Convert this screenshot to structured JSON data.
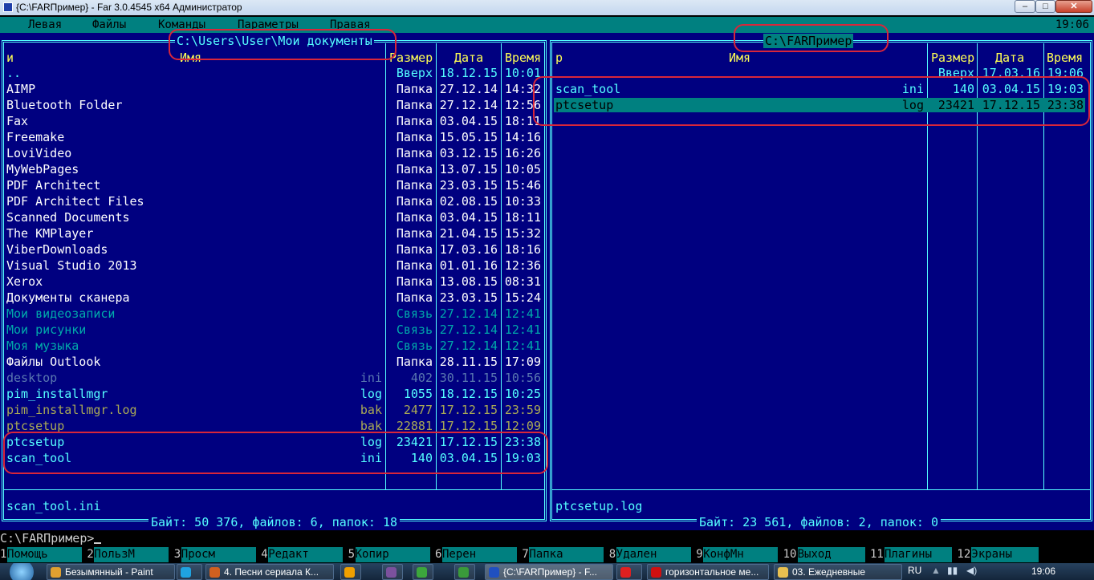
{
  "window": {
    "title": "{C:\\FARПример} - Far 3.0.4545 x64 Администратор",
    "min": "–",
    "max": "□",
    "close": "✕"
  },
  "menu": {
    "items": [
      "Левая",
      "Файлы",
      "Команды",
      "Параметры",
      "Правая"
    ],
    "clock": "19:06"
  },
  "left_panel": {
    "title": " C:\\Users\\User\\Мои документы ",
    "headers": {
      "n": "и",
      "name": "Имя",
      "size": "Размер",
      "date": "Дата",
      "time": "Время"
    },
    "rows": [
      {
        "name": "..",
        "ext": "",
        "size": "Вверх",
        "date": "18.12.15",
        "time": "10:01",
        "type": "up"
      },
      {
        "name": "AIMP",
        "ext": "",
        "size": "Папка",
        "date": "27.12.14",
        "time": "14:32",
        "type": "dir"
      },
      {
        "name": "Bluetooth Folder",
        "ext": "",
        "size": "Папка",
        "date": "27.12.14",
        "time": "12:56",
        "type": "dir"
      },
      {
        "name": "Fax",
        "ext": "",
        "size": "Папка",
        "date": "03.04.15",
        "time": "18:11",
        "type": "dir"
      },
      {
        "name": "Freemake",
        "ext": "",
        "size": "Папка",
        "date": "15.05.15",
        "time": "14:16",
        "type": "dir"
      },
      {
        "name": "LoviVideo",
        "ext": "",
        "size": "Папка",
        "date": "03.12.15",
        "time": "16:26",
        "type": "dir"
      },
      {
        "name": "MyWebPages",
        "ext": "",
        "size": "Папка",
        "date": "13.07.15",
        "time": "10:05",
        "type": "dir"
      },
      {
        "name": "PDF Architect",
        "ext": "",
        "size": "Папка",
        "date": "23.03.15",
        "time": "15:46",
        "type": "dir"
      },
      {
        "name": "PDF Architect Files",
        "ext": "",
        "size": "Папка",
        "date": "02.08.15",
        "time": "10:33",
        "type": "dir"
      },
      {
        "name": "Scanned Documents",
        "ext": "",
        "size": "Папка",
        "date": "03.04.15",
        "time": "18:11",
        "type": "dir"
      },
      {
        "name": "The KMPlayer",
        "ext": "",
        "size": "Папка",
        "date": "21.04.15",
        "time": "15:32",
        "type": "dir"
      },
      {
        "name": "ViberDownloads",
        "ext": "",
        "size": "Папка",
        "date": "17.03.16",
        "time": "18:16",
        "type": "dir"
      },
      {
        "name": "Visual Studio 2013",
        "ext": "",
        "size": "Папка",
        "date": "01.01.16",
        "time": "12:36",
        "type": "dir"
      },
      {
        "name": "Xerox",
        "ext": "",
        "size": "Папка",
        "date": "13.08.15",
        "time": "08:31",
        "type": "dir"
      },
      {
        "name": "Документы сканера",
        "ext": "",
        "size": "Папка",
        "date": "23.03.15",
        "time": "15:24",
        "type": "dir"
      },
      {
        "name": "Мои видеозаписи",
        "ext": "",
        "size": "Связь",
        "date": "27.12.14",
        "time": "12:41",
        "type": "link"
      },
      {
        "name": "Мои рисунки",
        "ext": "",
        "size": "Связь",
        "date": "27.12.14",
        "time": "12:41",
        "type": "link"
      },
      {
        "name": "Моя музыка",
        "ext": "",
        "size": "Связь",
        "date": "27.12.14",
        "time": "12:41",
        "type": "link"
      },
      {
        "name": "Файлы Outlook",
        "ext": "",
        "size": "Папка",
        "date": "28.11.15",
        "time": "17:09",
        "type": "dir"
      },
      {
        "name": "desktop",
        "ext": "ini",
        "size": "402",
        "date": "30.11.15",
        "time": "10:56",
        "type": "dim"
      },
      {
        "name": "pim_installmgr",
        "ext": "log",
        "size": "1055",
        "date": "18.12.15",
        "time": "10:25",
        "type": "file"
      },
      {
        "name": "pim_installmgr.log",
        "ext": "bak",
        "size": "2477",
        "date": "17.12.15",
        "time": "23:59",
        "type": "bak"
      },
      {
        "name": "ptcsetup",
        "ext": "bak",
        "size": "22881",
        "date": "17.12.15",
        "time": "12:09",
        "type": "bak"
      },
      {
        "name": "ptcsetup",
        "ext": "log",
        "size": "23421",
        "date": "17.12.15",
        "time": "23:38",
        "type": "file"
      },
      {
        "name": "scan_tool",
        "ext": "ini",
        "size": "140",
        "date": "03.04.15",
        "time": "19:03",
        "type": "file"
      }
    ],
    "info": "scan_tool.ini",
    "summary": " Байт: 50 376, файлов: 6, папок: 18 "
  },
  "right_panel": {
    "title": " C:\\FARПример ",
    "headers": {
      "n": "р",
      "name": "Имя",
      "size": "Размер",
      "date": "Дата",
      "time": "Время"
    },
    "rows": [
      {
        "name": "",
        "ext": "",
        "size": "Вверх",
        "date": "17.03.16",
        "time": "19:06",
        "type": "up"
      },
      {
        "name": "scan_tool",
        "ext": "ini",
        "size": "140",
        "date": "03.04.15",
        "time": "19:03",
        "type": "file"
      },
      {
        "name": "ptcsetup",
        "ext": "log",
        "size": "23421",
        "date": "17.12.15",
        "time": "23:38",
        "type": "cursor"
      }
    ],
    "info": "ptcsetup.log",
    "summary": " Байт: 23 561, файлов: 2, папок: 0 "
  },
  "cmdline": {
    "prompt": "C:\\FARПример>"
  },
  "keybar": [
    {
      "n": "1",
      "label": "Помощь"
    },
    {
      "n": "2",
      "label": "ПользМ"
    },
    {
      "n": "3",
      "label": "Просм"
    },
    {
      "n": "4",
      "label": "Редакт"
    },
    {
      "n": "5",
      "label": "Копир"
    },
    {
      "n": "6",
      "label": "Перен"
    },
    {
      "n": "7",
      "label": "Папка"
    },
    {
      "n": "8",
      "label": "Удален"
    },
    {
      "n": "9",
      "label": "КонфМн"
    },
    {
      "n": "10",
      "label": "Выход"
    },
    {
      "n": "11",
      "label": "Плагины"
    },
    {
      "n": "12",
      "label": "Экраны"
    }
  ],
  "taskbar": {
    "items": [
      {
        "label": "Безымянный - Paint",
        "icon": "paint-icon",
        "color": "#e0a030"
      },
      {
        "label": "",
        "icon": "skype-icon",
        "color": "#1fa3e0"
      },
      {
        "label": "4. Песни сериала К...",
        "icon": "media-icon",
        "color": "#d06020"
      },
      {
        "label": "",
        "icon": "aimp-icon",
        "color": "#f0a000"
      },
      {
        "label": "",
        "icon": "viber-icon",
        "color": "#7b519d"
      },
      {
        "label": "",
        "icon": "utorrent-icon",
        "color": "#3ca63c"
      },
      {
        "label": "",
        "icon": "chrome-icon",
        "color": "#3a9a3a"
      },
      {
        "label": "{C:\\FARПример} - F...",
        "icon": "far-icon",
        "color": "#2050c0"
      },
      {
        "label": "",
        "icon": "yandex-icon",
        "color": "#e02020"
      },
      {
        "label": "горизонтальное ме...",
        "icon": "opera-icon",
        "color": "#d01010"
      },
      {
        "label": "03. Ежедневные",
        "icon": "folder-icon",
        "color": "#e8c050"
      }
    ],
    "lang": "RU",
    "clock": "19:06"
  }
}
